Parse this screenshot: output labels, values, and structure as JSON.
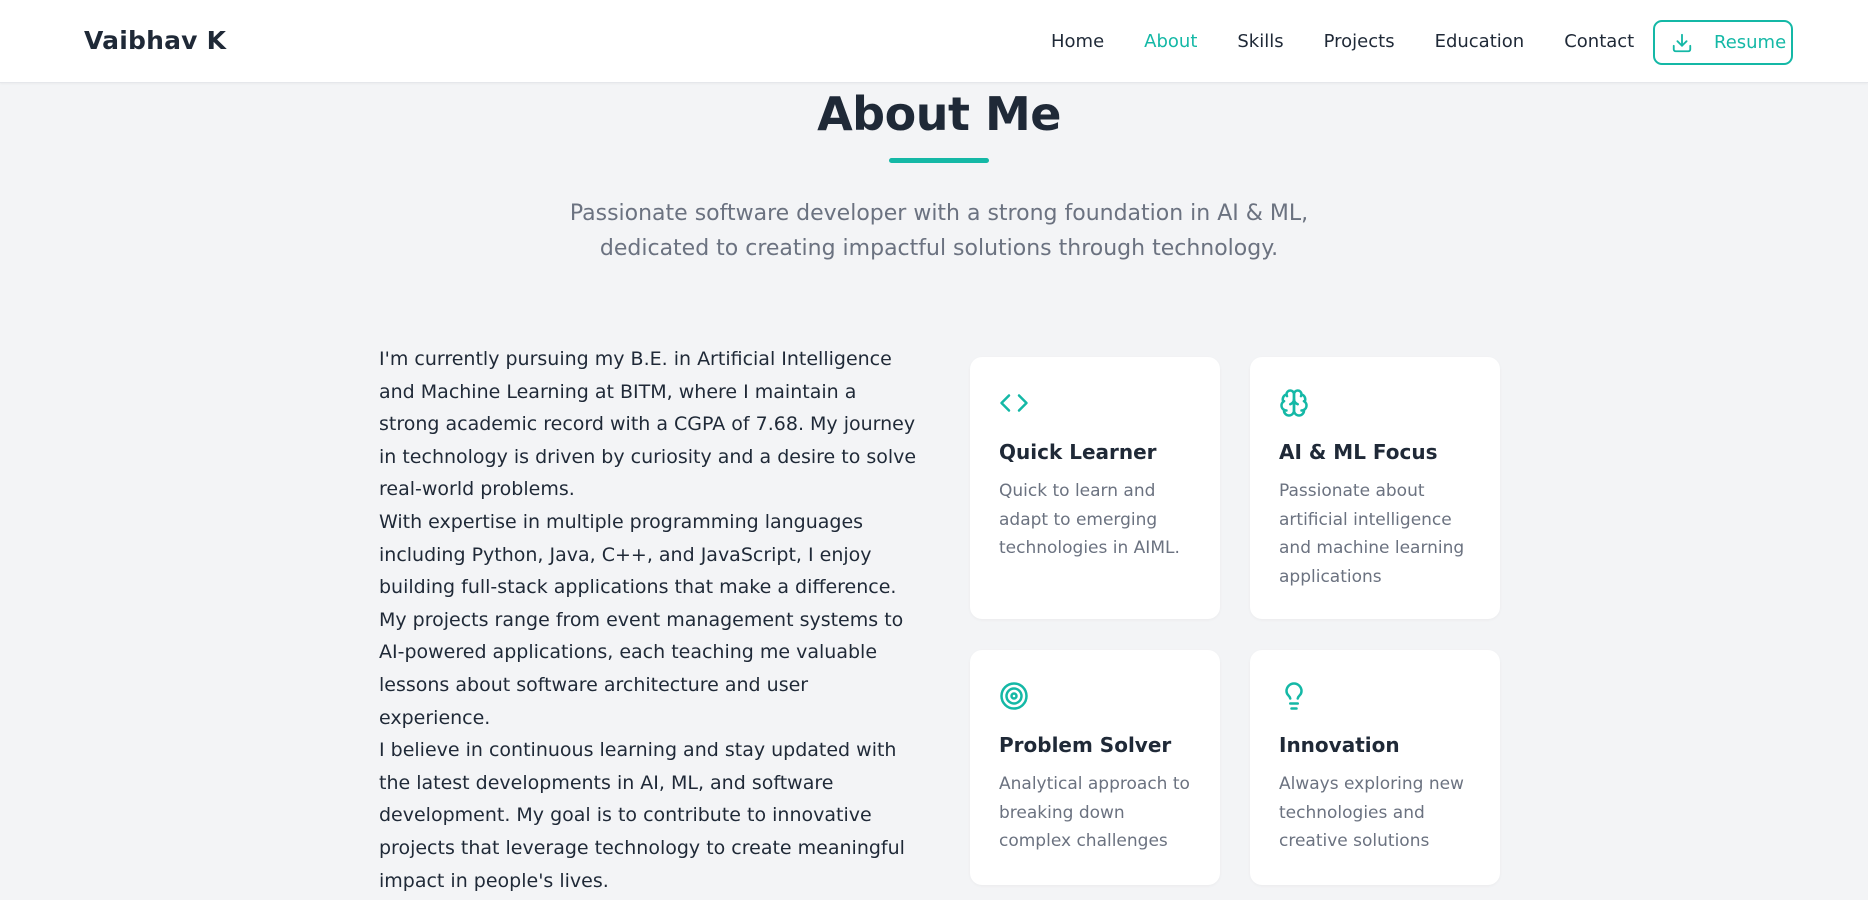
{
  "colors": {
    "accent": "#14b8a6",
    "text_dark": "#1f2937",
    "text_muted": "#6b7280",
    "background": "#f3f4f6",
    "card_background": "#ffffff"
  },
  "navbar": {
    "brand": "Vaibhav K",
    "links": [
      {
        "label": "Home",
        "active": false
      },
      {
        "label": "About",
        "active": true
      },
      {
        "label": "Skills",
        "active": false
      },
      {
        "label": "Projects",
        "active": false
      },
      {
        "label": "Education",
        "active": false
      },
      {
        "label": "Contact",
        "active": false
      }
    ],
    "resume_button": {
      "label": "Resume",
      "icon": "download-icon"
    }
  },
  "about": {
    "title": "About Me",
    "subtitle": "Passionate software developer with a strong foundation in AI & ML, dedicated to creating impactful solutions through technology.",
    "paragraphs": [
      "I'm currently pursuing my B.E. in Artificial Intelligence and Machine Learning at BITM, where I maintain a strong academic record with a CGPA of 7.68. My journey in technology is driven by curiosity and a desire to solve real-world problems.",
      "With expertise in multiple programming languages including Python, Java, C++, and JavaScript, I enjoy building full-stack applications that make a difference. My projects range from event management systems to AI-powered applications, each teaching me valuable lessons about software architecture and user experience.",
      "I believe in continuous learning and stay updated with the latest developments in AI, ML, and software development. My goal is to contribute to innovative projects that leverage technology to create meaningful impact in people's lives."
    ],
    "cards": [
      {
        "icon": "code-icon",
        "title": "Quick Learner",
        "description": "Quick to learn and adapt to emerging technologies in AIML."
      },
      {
        "icon": "brain-icon",
        "title": "AI & ML Focus",
        "description": "Passionate about artificial intelligence and machine learning applications"
      },
      {
        "icon": "target-icon",
        "title": "Problem Solver",
        "description": "Analytical approach to breaking down complex challenges"
      },
      {
        "icon": "lightbulb-icon",
        "title": "Innovation",
        "description": "Always exploring new technologies and creative solutions"
      }
    ]
  }
}
